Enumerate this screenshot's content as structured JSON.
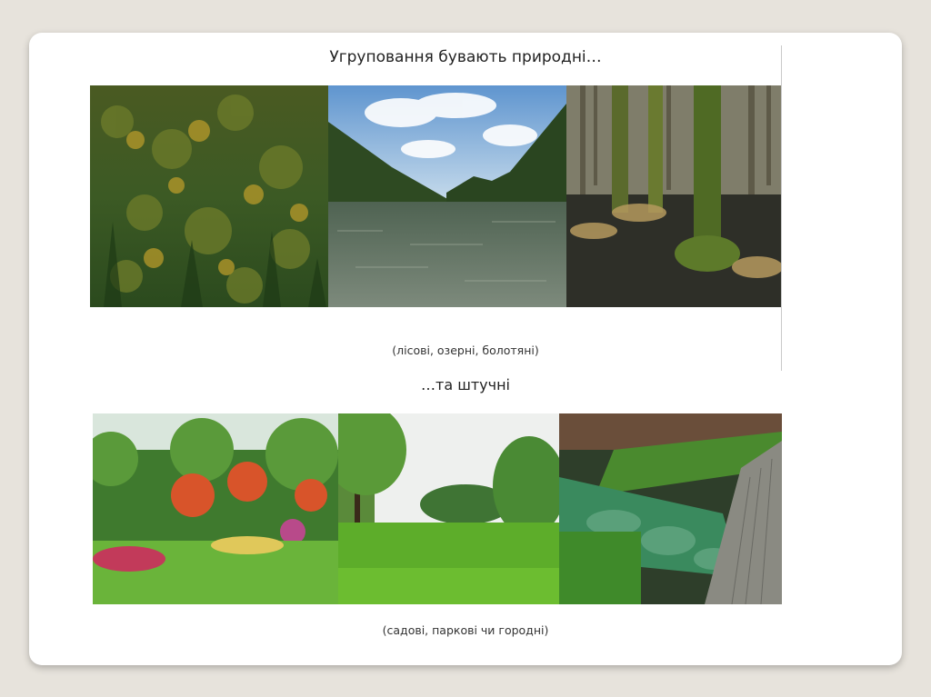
{
  "slide": {
    "natural_title": "Угруповання бувають природні…",
    "natural_caption": "(лісові, озерні, болотяні)",
    "artificial_title": "…та штучні",
    "artificial_caption": "(садові, паркові чи городні)"
  }
}
